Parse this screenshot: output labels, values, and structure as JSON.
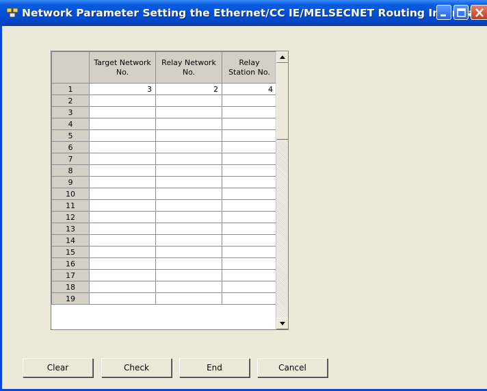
{
  "window": {
    "title": "Network Parameter  Setting the Ethernet/CC IE/MELSECNET Routing Information",
    "controls": [
      "minimize-icon",
      "maximize-icon",
      "close-icon"
    ]
  },
  "grid": {
    "headers": {
      "row": "",
      "target_line1": "Target Network",
      "target_line2": "No.",
      "relay_net_line1": "Relay Network",
      "relay_net_line2": "No.",
      "relay_station_line1": "Relay",
      "relay_station_line2": "Station No."
    },
    "rows": [
      {
        "num": "1",
        "target": "3",
        "relay_net": "2",
        "relay_station": "4"
      },
      {
        "num": "2",
        "target": "",
        "relay_net": "",
        "relay_station": ""
      },
      {
        "num": "3",
        "target": "",
        "relay_net": "",
        "relay_station": ""
      },
      {
        "num": "4",
        "target": "",
        "relay_net": "",
        "relay_station": ""
      },
      {
        "num": "5",
        "target": "",
        "relay_net": "",
        "relay_station": ""
      },
      {
        "num": "6",
        "target": "",
        "relay_net": "",
        "relay_station": ""
      },
      {
        "num": "7",
        "target": "",
        "relay_net": "",
        "relay_station": ""
      },
      {
        "num": "8",
        "target": "",
        "relay_net": "",
        "relay_station": ""
      },
      {
        "num": "9",
        "target": "",
        "relay_net": "",
        "relay_station": ""
      },
      {
        "num": "10",
        "target": "",
        "relay_net": "",
        "relay_station": ""
      },
      {
        "num": "11",
        "target": "",
        "relay_net": "",
        "relay_station": ""
      },
      {
        "num": "12",
        "target": "",
        "relay_net": "",
        "relay_station": ""
      },
      {
        "num": "13",
        "target": "",
        "relay_net": "",
        "relay_station": ""
      },
      {
        "num": "14",
        "target": "",
        "relay_net": "",
        "relay_station": ""
      },
      {
        "num": "15",
        "target": "",
        "relay_net": "",
        "relay_station": ""
      },
      {
        "num": "16",
        "target": "",
        "relay_net": "",
        "relay_station": ""
      },
      {
        "num": "17",
        "target": "",
        "relay_net": "",
        "relay_station": ""
      },
      {
        "num": "18",
        "target": "",
        "relay_net": "",
        "relay_station": ""
      },
      {
        "num": "19",
        "target": "",
        "relay_net": "",
        "relay_station": ""
      }
    ]
  },
  "buttons": {
    "clear": "Clear",
    "check": "Check",
    "end": "End",
    "cancel": "Cancel"
  },
  "colors": {
    "titlebar": "#0450D8",
    "dialog_bg": "#ECE9D8",
    "header_bg": "#D4D0C8"
  }
}
